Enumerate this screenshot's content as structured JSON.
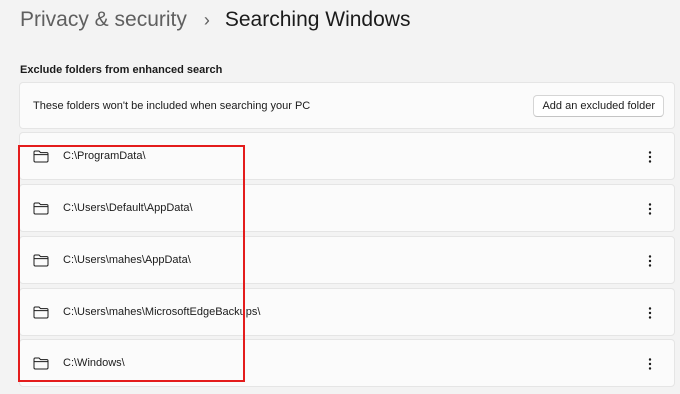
{
  "breadcrumb": {
    "parent": "Privacy & security",
    "separator": "›",
    "current": "Searching Windows"
  },
  "section": {
    "title": "Exclude folders from enhanced search"
  },
  "info": {
    "text": "These folders won't be included when searching your PC",
    "add_button_label": "Add an excluded folder"
  },
  "folders": [
    {
      "path": "C:\\ProgramData\\",
      "icon": "folder-icon",
      "menu_icon": "more-options-icon"
    },
    {
      "path": "C:\\Users\\Default\\AppData\\",
      "icon": "folder-icon",
      "menu_icon": "more-options-icon"
    },
    {
      "path": "C:\\Users\\mahes\\AppData\\",
      "icon": "folder-icon",
      "menu_icon": "more-options-icon"
    },
    {
      "path": "C:\\Users\\mahes\\MicrosoftEdgeBackups\\",
      "icon": "folder-icon",
      "menu_icon": "more-options-icon"
    },
    {
      "path": "C:\\Windows\\",
      "icon": "folder-icon",
      "menu_icon": "more-options-icon"
    }
  ],
  "colors": {
    "background": "#f3f3f3",
    "card": "#fbfbfb",
    "highlight": "#e41c1c"
  }
}
